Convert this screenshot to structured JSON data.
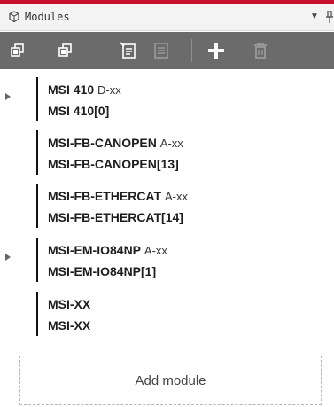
{
  "panel": {
    "title": "Modules",
    "header_icon": "modules-icon",
    "dropdown_icon": "chevron-down-icon",
    "pin_icon": "pin-icon"
  },
  "toolbar": {
    "buttons": [
      {
        "name": "collapse-all-icon",
        "enabled": true
      },
      {
        "name": "expand-all-icon",
        "enabled": true
      },
      {
        "name": "edit-module-icon",
        "enabled": true
      },
      {
        "name": "module-settings-icon",
        "enabled": false
      },
      {
        "name": "add-icon",
        "enabled": true
      },
      {
        "name": "delete-icon",
        "enabled": false
      }
    ]
  },
  "modules": [
    {
      "name": "MSI 410",
      "version": "D-xx",
      "instance": "MSI 410[0]",
      "expandable": true
    },
    {
      "name": "MSI-FB-CANOPEN",
      "version": "A-xx",
      "instance": "MSI-FB-CANOPEN[13]",
      "expandable": false
    },
    {
      "name": "MSI-FB-ETHERCAT",
      "version": "A-xx",
      "instance": "MSI-FB-ETHERCAT[14]",
      "expandable": false
    },
    {
      "name": "MSI-EM-IO84NP",
      "version": "A-xx",
      "instance": "MSI-EM-IO84NP[1]",
      "expandable": true
    },
    {
      "name": "MSI-XX",
      "version": "",
      "instance": "MSI-XX",
      "expandable": false
    }
  ],
  "add_module_label": "Add module",
  "colors": {
    "accent": "#c8102e",
    "toolbar_bg": "#6b6b6b",
    "icon_enabled": "#ffffff",
    "icon_disabled": "#9a9a9a"
  }
}
